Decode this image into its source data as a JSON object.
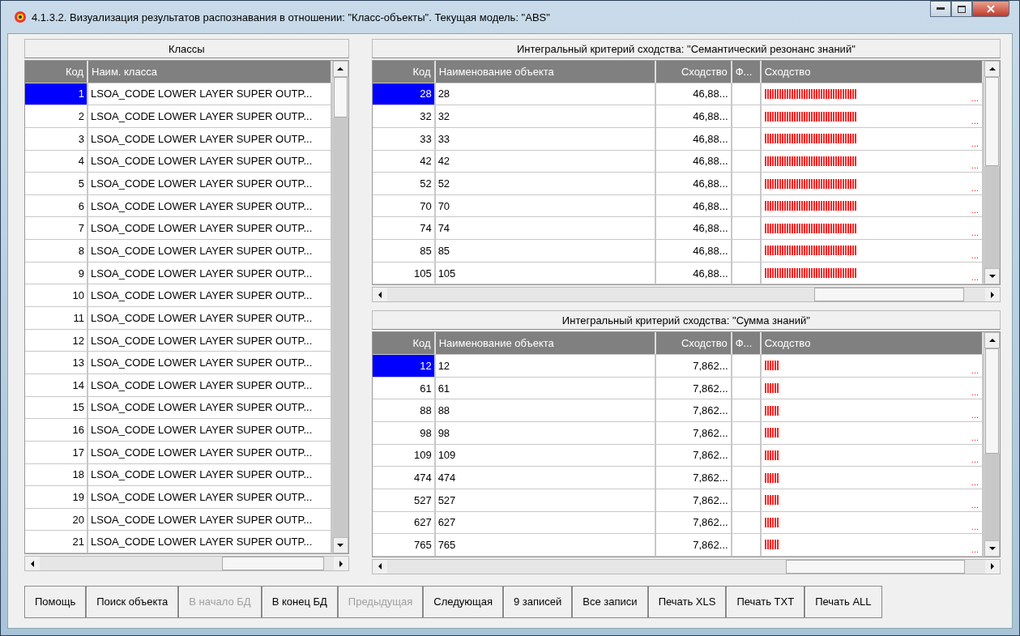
{
  "window": {
    "title": "4.1.3.2. Визуализация результатов распознавания в отношении: \"Класс-объекты\". Текущая модель: \"ABS\""
  },
  "classes": {
    "title": "Классы",
    "columns": [
      "Код",
      "Наим. класса"
    ],
    "rows": [
      {
        "code": "1",
        "name": "LSOA_CODE LOWER LAYER SUPER OUTP...",
        "selected": true
      },
      {
        "code": "2",
        "name": "LSOA_CODE LOWER LAYER SUPER OUTP...",
        "selected": false
      },
      {
        "code": "3",
        "name": "LSOA_CODE LOWER LAYER SUPER OUTP...",
        "selected": false
      },
      {
        "code": "4",
        "name": "LSOA_CODE LOWER LAYER SUPER OUTP...",
        "selected": false
      },
      {
        "code": "5",
        "name": "LSOA_CODE LOWER LAYER SUPER OUTP...",
        "selected": false
      },
      {
        "code": "6",
        "name": "LSOA_CODE LOWER LAYER SUPER OUTP...",
        "selected": false
      },
      {
        "code": "7",
        "name": "LSOA_CODE LOWER LAYER SUPER OUTP...",
        "selected": false
      },
      {
        "code": "8",
        "name": "LSOA_CODE LOWER LAYER SUPER OUTP...",
        "selected": false
      },
      {
        "code": "9",
        "name": "LSOA_CODE LOWER LAYER SUPER OUTP...",
        "selected": false
      },
      {
        "code": "10",
        "name": "LSOA_CODE LOWER LAYER SUPER OUTP...",
        "selected": false
      },
      {
        "code": "11",
        "name": "LSOA_CODE LOWER LAYER SUPER OUTP...",
        "selected": false
      },
      {
        "code": "12",
        "name": "LSOA_CODE LOWER LAYER SUPER OUTP...",
        "selected": false
      },
      {
        "code": "13",
        "name": "LSOA_CODE LOWER LAYER SUPER OUTP...",
        "selected": false
      },
      {
        "code": "14",
        "name": "LSOA_CODE LOWER LAYER SUPER OUTP...",
        "selected": false
      },
      {
        "code": "15",
        "name": "LSOA_CODE LOWER LAYER SUPER OUTP...",
        "selected": false
      },
      {
        "code": "16",
        "name": "LSOA_CODE LOWER LAYER SUPER OUTP...",
        "selected": false
      },
      {
        "code": "17",
        "name": "LSOA_CODE LOWER LAYER SUPER OUTP...",
        "selected": false
      },
      {
        "code": "18",
        "name": "LSOA_CODE LOWER LAYER SUPER OUTP...",
        "selected": false
      },
      {
        "code": "19",
        "name": "LSOA_CODE LOWER LAYER SUPER OUTP...",
        "selected": false
      },
      {
        "code": "20",
        "name": "LSOA_CODE LOWER LAYER SUPER OUTP...",
        "selected": false
      },
      {
        "code": "21",
        "name": "LSOA_CODE LOWER LAYER SUPER OUTP...",
        "selected": false
      }
    ]
  },
  "object_tables": [
    {
      "title": "Интегральный критерий сходства: \"Семантический резонанс знаний\"",
      "columns": [
        "Код",
        "Наименование объекта",
        "Сходство",
        "Ф...",
        "Сходство"
      ],
      "rows": [
        {
          "code": "28",
          "name": "28",
          "similarity": "46,88...",
          "level": 0.43,
          "more": "...",
          "selected": true
        },
        {
          "code": "32",
          "name": "32",
          "similarity": "46,88...",
          "level": 0.43,
          "more": "...",
          "selected": false
        },
        {
          "code": "33",
          "name": "33",
          "similarity": "46,88...",
          "level": 0.43,
          "more": "...",
          "selected": false
        },
        {
          "code": "42",
          "name": "42",
          "similarity": "46,88...",
          "level": 0.43,
          "more": "...",
          "selected": false
        },
        {
          "code": "52",
          "name": "52",
          "similarity": "46,88...",
          "level": 0.43,
          "more": "...",
          "selected": false
        },
        {
          "code": "70",
          "name": "70",
          "similarity": "46,88...",
          "level": 0.43,
          "more": "...",
          "selected": false
        },
        {
          "code": "74",
          "name": "74",
          "similarity": "46,88...",
          "level": 0.43,
          "more": "...",
          "selected": false
        },
        {
          "code": "85",
          "name": "85",
          "similarity": "46,88...",
          "level": 0.43,
          "more": "...",
          "selected": false
        },
        {
          "code": "105",
          "name": "105",
          "similarity": "46,88...",
          "level": 0.43,
          "more": "...",
          "selected": false
        }
      ]
    },
    {
      "title": "Интегральный критерий сходства: \"Сумма знаний\"",
      "columns": [
        "Код",
        "Наименование объекта",
        "Сходство",
        "Ф...",
        "Сходство"
      ],
      "rows": [
        {
          "code": "12",
          "name": "12",
          "similarity": "7,862...",
          "level": 0.065,
          "more": "...",
          "selected": true
        },
        {
          "code": "61",
          "name": "61",
          "similarity": "7,862...",
          "level": 0.065,
          "more": "...",
          "selected": false
        },
        {
          "code": "88",
          "name": "88",
          "similarity": "7,862...",
          "level": 0.065,
          "more": "...",
          "selected": false
        },
        {
          "code": "98",
          "name": "98",
          "similarity": "7,862...",
          "level": 0.065,
          "more": "...",
          "selected": false
        },
        {
          "code": "109",
          "name": "109",
          "similarity": "7,862...",
          "level": 0.065,
          "more": "...",
          "selected": false
        },
        {
          "code": "474",
          "name": "474",
          "similarity": "7,862...",
          "level": 0.065,
          "more": "...",
          "selected": false
        },
        {
          "code": "527",
          "name": "527",
          "similarity": "7,862...",
          "level": 0.065,
          "more": "...",
          "selected": false
        },
        {
          "code": "627",
          "name": "627",
          "similarity": "7,862...",
          "level": 0.065,
          "more": "...",
          "selected": false
        },
        {
          "code": "765",
          "name": "765",
          "similarity": "7,862...",
          "level": 0.065,
          "more": "...",
          "selected": false
        }
      ]
    }
  ],
  "buttons": [
    {
      "label": "Помощь",
      "disabled": false
    },
    {
      "label": "Поиск объекта",
      "disabled": false
    },
    {
      "label": "В начало БД",
      "disabled": true
    },
    {
      "label": "В конец БД",
      "disabled": false
    },
    {
      "label": "Предыдущая",
      "disabled": true
    },
    {
      "label": "Следующая",
      "disabled": false
    },
    {
      "label": "9 записей",
      "disabled": false
    },
    {
      "label": "Все записи",
      "disabled": false
    },
    {
      "label": "Печать XLS",
      "disabled": false
    },
    {
      "label": "Печать TXT",
      "disabled": false
    },
    {
      "label": "Печать ALL",
      "disabled": false
    }
  ]
}
